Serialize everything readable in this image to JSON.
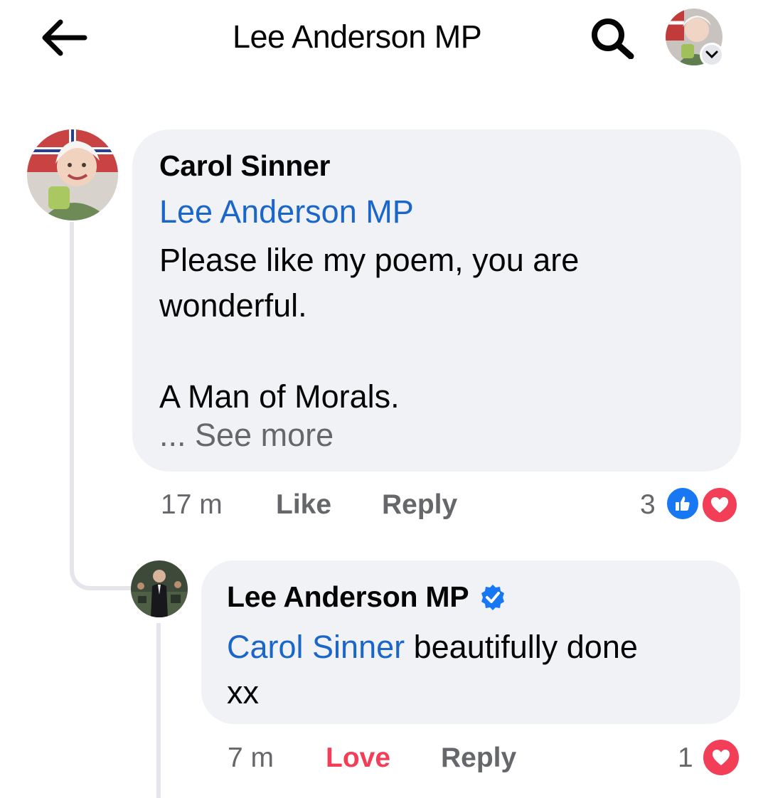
{
  "header": {
    "title": "Lee Anderson MP",
    "back_icon": "arrow-left-icon",
    "search_icon": "search-icon",
    "profile_icon": "chevron-down-icon"
  },
  "comment": {
    "author": "Carol Sinner",
    "mention": "Lee Anderson MP",
    "body_line1": "Please like my poem, you are wonderful.",
    "body_line2": "A Man of Morals.",
    "see_more": "... See more",
    "time": "17 m",
    "like_label": "Like",
    "reply_label": "Reply",
    "reaction_count": "3",
    "reactions": [
      "like-icon",
      "love-icon"
    ]
  },
  "reply": {
    "author": "Lee Anderson MP",
    "verified_icon": "verified-badge-icon",
    "mention": "Carol Sinner",
    "text": " beautifully done",
    "text_line2": "xx",
    "time": "7 m",
    "love_label": "Love",
    "reply_label": "Reply",
    "reaction_count": "1",
    "reactions": [
      "love-icon"
    ]
  },
  "colors": {
    "link_blue": "#1a66c9",
    "bubble_bg": "#f0f2f5",
    "meta_gray": "#65676b",
    "love_red": "#f33e58",
    "like_blue": "#1877f2",
    "verified_blue": "#1877f2"
  }
}
